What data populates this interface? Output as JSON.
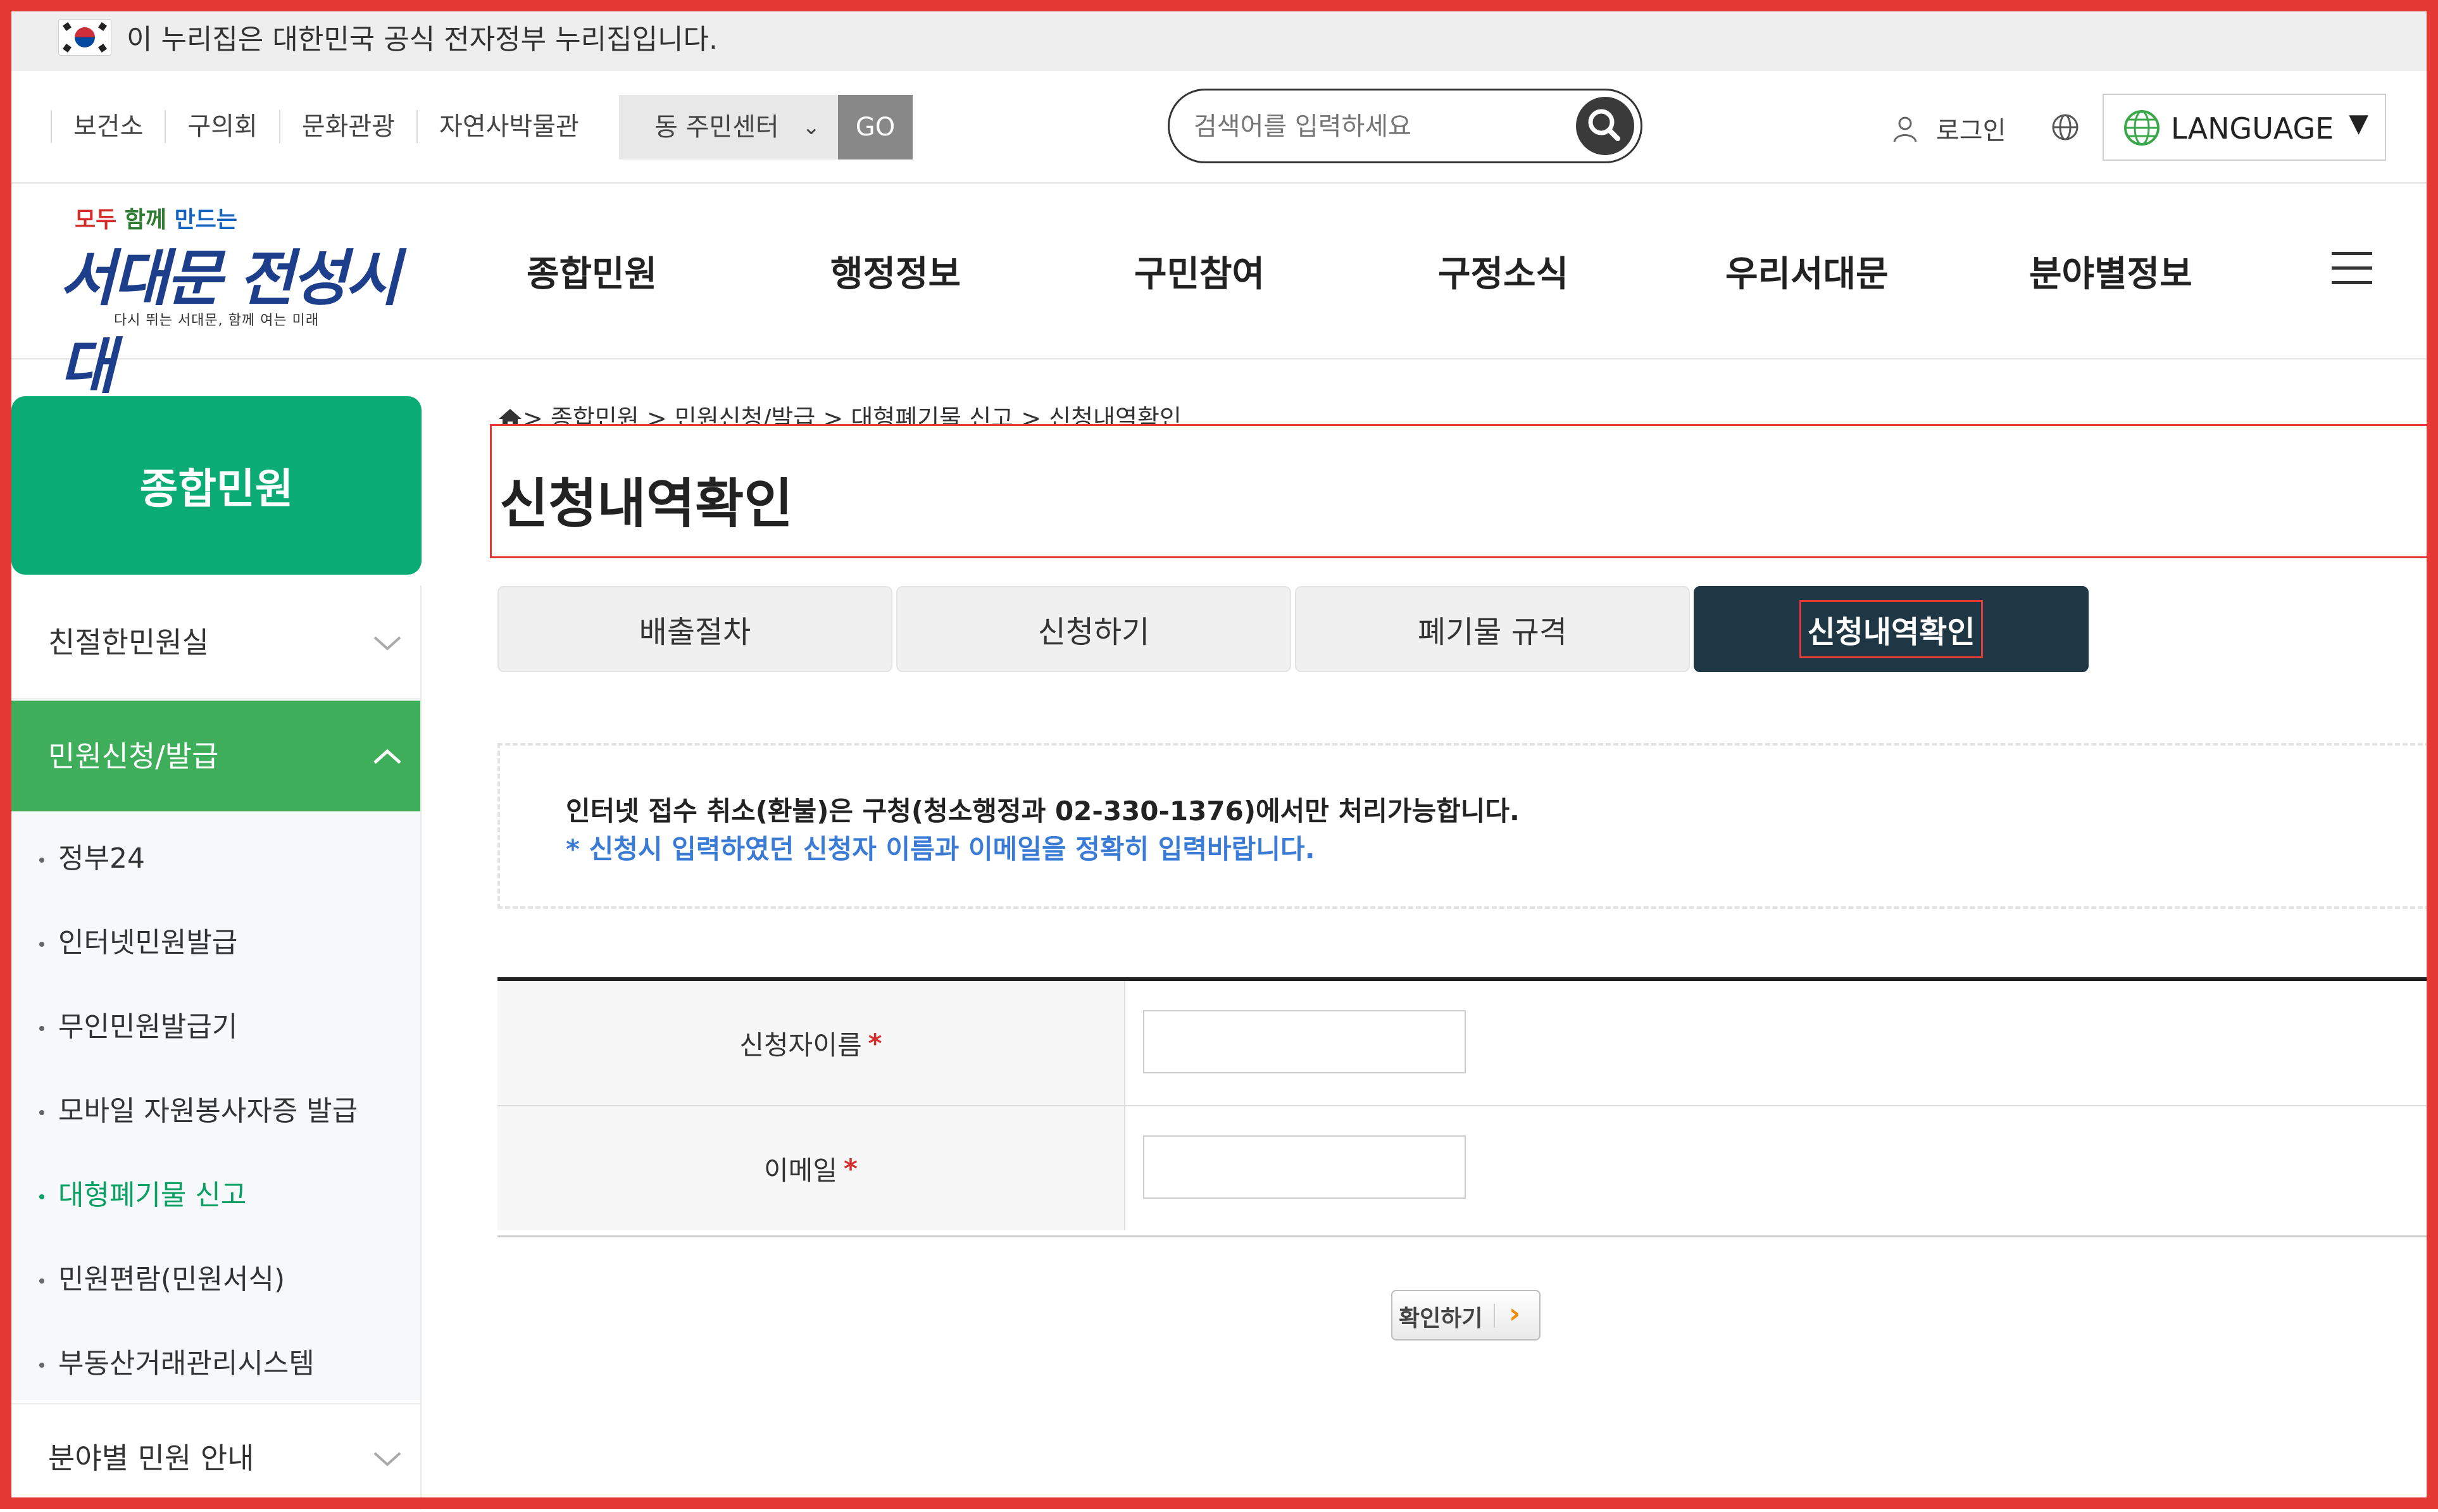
{
  "gov_banner": {
    "text": "이 누리집은 대한민국 공식 전자정부 누리집입니다."
  },
  "utility": {
    "links": [
      "보건소",
      "구의회",
      "문화관광",
      "자연사박물관"
    ],
    "community_select": {
      "selected": "동 주민센터"
    },
    "go_label": "GO",
    "search": {
      "placeholder": "검색어를 입력하세요"
    },
    "login_label": "로그인",
    "language_label": "LANGUAGE"
  },
  "header": {
    "logo": {
      "slogan": [
        "모두",
        "함께",
        "만드는",
        ""
      ],
      "title": "서대문 전성시대",
      "subtitle": "다시 뛰는 서대문, 함께 여는 미래"
    },
    "nav": [
      "종합민원",
      "행정정보",
      "구민참여",
      "구정소식",
      "우리서대문",
      "분야별정보"
    ]
  },
  "sidebar": {
    "title": "종합민원",
    "sections": [
      {
        "label": "친절한민원실",
        "expanded": false
      },
      {
        "label": "민원신청/발급",
        "expanded": true
      },
      {
        "label": "분야별 민원 안내",
        "expanded": false
      }
    ],
    "sub_items": [
      {
        "label": "정부24"
      },
      {
        "label": "인터넷민원발급"
      },
      {
        "label": "무인민원발급기"
      },
      {
        "label": "모바일 자원봉사자증 발급"
      },
      {
        "label": "대형폐기물 신고",
        "current": true
      },
      {
        "label": "민원편람(민원서식)"
      },
      {
        "label": "부동산거래관리시스템"
      }
    ]
  },
  "content": {
    "breadcrumb": "> 종합민원 > 민원신청/발급 > 대형폐기물 신고 > 신청내역확인",
    "title": "신청내역확인",
    "tabs": [
      {
        "label": "배출절차"
      },
      {
        "label": "신청하기"
      },
      {
        "label": "폐기물 규격"
      },
      {
        "label": "신청내역확인",
        "active": true
      }
    ],
    "notice": {
      "line1": "인터넷 접수 취소(환불)은 구청(청소행정과 02-330-1376)에서만 처리가능합니다.",
      "line2": "* 신청시 입력하였던 신청자 이름과 이메일을 정확히 입력바랍니다."
    },
    "form": {
      "name_label": "신청자이름",
      "email_label": "이메일",
      "required_mark": "*",
      "name_value": "",
      "email_value": ""
    },
    "confirm_label": "확인하기"
  },
  "colors": {
    "brand_green": "#0aab74",
    "active_section": "#3fae5a",
    "active_tab": "#1f3744",
    "notice_blue": "#3a7bd5",
    "frame_red": "#e53935"
  }
}
